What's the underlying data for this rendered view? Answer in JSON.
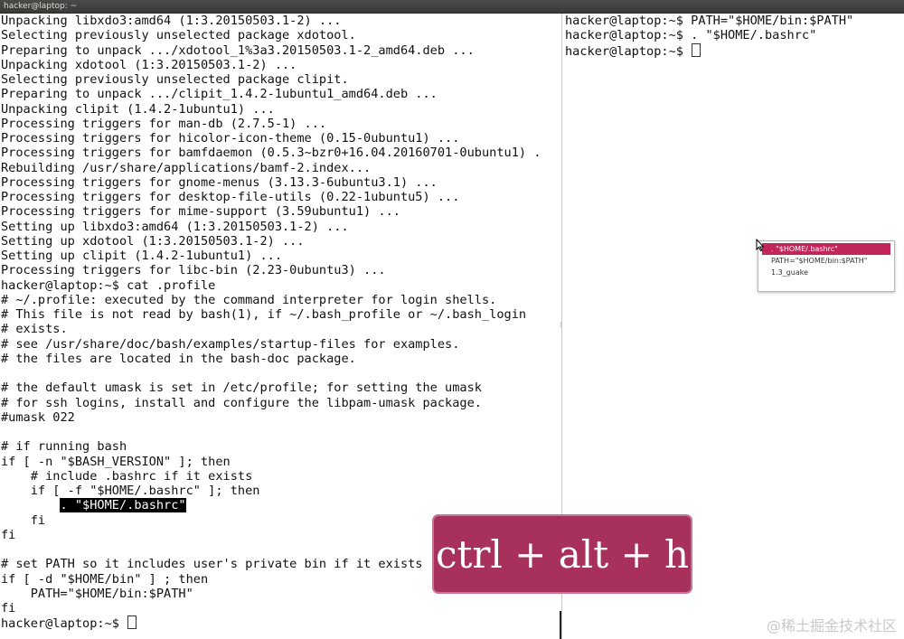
{
  "window": {
    "title": "hacker@laptop: ~"
  },
  "left_terminal": {
    "lines": [
      "Unpacking libxdo3:amd64 (1:3.20150503.1-2) ...",
      "Selecting previously unselected package xdotool.",
      "Preparing to unpack .../xdotool_1%3a3.20150503.1-2_amd64.deb ...",
      "Unpacking xdotool (1:3.20150503.1-2) ...",
      "Selecting previously unselected package clipit.",
      "Preparing to unpack .../clipit_1.4.2-1ubuntu1_amd64.deb ...",
      "Unpacking clipit (1.4.2-1ubuntu1) ...",
      "Processing triggers for man-db (2.7.5-1) ...",
      "Processing triggers for hicolor-icon-theme (0.15-0ubuntu1) ...",
      "Processing triggers for bamfdaemon (0.5.3~bzr0+16.04.20160701-0ubuntu1) .",
      "Rebuilding /usr/share/applications/bamf-2.index...",
      "Processing triggers for gnome-menus (3.13.3-6ubuntu3.1) ...",
      "Processing triggers for desktop-file-utils (0.22-1ubuntu5) ...",
      "Processing triggers for mime-support (3.59ubuntu1) ...",
      "Setting up libxdo3:amd64 (1:3.20150503.1-2) ...",
      "Setting up xdotool (1:3.20150503.1-2) ...",
      "Setting up clipit (1.4.2-1ubuntu1) ...",
      "Processing triggers for libc-bin (2.23-0ubuntu3) ...",
      "hacker@laptop:~$ cat .profile",
      "# ~/.profile: executed by the command interpreter for login shells.",
      "# This file is not read by bash(1), if ~/.bash_profile or ~/.bash_login",
      "# exists.",
      "# see /usr/share/doc/bash/examples/startup-files for examples.",
      "# the files are located in the bash-doc package.",
      "",
      "# the default umask is set in /etc/profile; for setting the umask",
      "# for ssh logins, install and configure the libpam-umask package.",
      "#umask 022",
      "",
      "# if running bash",
      "if [ -n \"$BASH_VERSION\" ]; then",
      "    # include .bashrc if it exists",
      "    if [ -f \"$HOME/.bashrc\" ]; then"
    ],
    "selected_line_indent": "        ",
    "selected_text": ". \"$HOME/.bashrc\"",
    "lines_after": [
      "    fi",
      "fi",
      "",
      "# set PATH so it includes user's private bin if it exists",
      "if [ -d \"$HOME/bin\" ] ; then",
      "    PATH=\"$HOME/bin:$PATH\"",
      "fi"
    ],
    "prompt": "hacker@laptop:~$ "
  },
  "right_terminal": {
    "lines": [
      "hacker@laptop:~$ PATH=\"$HOME/bin:$PATH\"",
      "hacker@laptop:~$ . \"$HOME/.bashrc\""
    ],
    "prompt": "hacker@laptop:~$ "
  },
  "clipboard_popup": {
    "items": [
      ". \"$HOME/.bashrc\"",
      "PATH=\"$HOME/bin:$PATH\"",
      "1.3_guake"
    ],
    "active_index": 0
  },
  "key_overlay": {
    "text": "ctrl + alt + h"
  },
  "watermark": {
    "text": "@稀土掘金技术社区"
  },
  "colors": {
    "overlay": "#a7305d",
    "popup_highlight": "#c3265a",
    "terminal_text": "#111111",
    "terminal_bg": "#ffffff"
  }
}
